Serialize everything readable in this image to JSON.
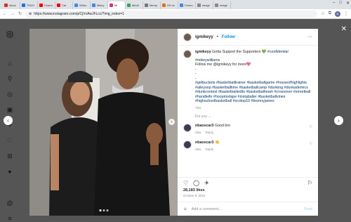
{
  "browser": {
    "tabs": [
      {
        "label": "Inbox",
        "color": "#d93025"
      },
      {
        "label": "TKWY",
        "color": "#1a73e8"
      },
      {
        "label": "Chann",
        "color": "#ff0000"
      },
      {
        "label": "Cal",
        "color": "#ff0000"
      },
      {
        "label": "When",
        "color": "#4285f4"
      },
      {
        "label": "Mikey",
        "color": "#4285f4"
      },
      {
        "label": "Mi",
        "color": "#e1306c"
      },
      {
        "label": "dfkdd",
        "color": "#34a853"
      },
      {
        "label": "Memp",
        "color": "#777"
      },
      {
        "label": "HS hc",
        "color": "#e8710a"
      },
      {
        "label": "Freem",
        "color": "#4285f4"
      },
      {
        "label": "image",
        "color": "#888"
      },
      {
        "label": "image",
        "color": "#888"
      }
    ],
    "url": "https://www.instagram.com/p/CjVvAwJFLcc/?img_index=1",
    "profile_initial": "N"
  },
  "post": {
    "username": "igmikeyy",
    "follow_label": "Follow",
    "more_label": "···",
    "caption_user": "igmikeyy",
    "caption_line1": "Gotta Support the Supporters 💚",
    "caption_tag1": "#confidential",
    "caption_tag2": "#mikeywilliams",
    "caption_follow": "Follow me @igmikeyy for more💖",
    "caption_dashes": "-\n-\n-",
    "hashtags": "#getbuckets #basketballtrainer #basketballgame #houseofhighlights #alleyoop #basketballtime #basketballcamp #dunking #dunkademics #dunkcontest #basketballedits #basketballteam #crossover #streetball #handleife #hoopmixtape #instaballer #basketballvines #highschoolbasketball #scotop10 #bronnyjames",
    "caption_time": "70w",
    "for_you_label": "For you ⌄",
    "comments": [
      {
        "user": "nbaoscar3",
        "text": "Good bro",
        "time": "28w",
        "reply": "Reply"
      },
      {
        "user": "nbaoscar3",
        "text": "👏",
        "time": "28w",
        "reply": "Reply"
      }
    ],
    "likes": "28,183 likes",
    "date": "October 5, 2022",
    "add_comment_placeholder": "Add a comment...",
    "post_label": "Post"
  },
  "sidebar_icons": [
    "instagram-icon",
    "home-icon",
    "search-icon",
    "explore-icon",
    "reels-icon",
    "messages-icon",
    "notifications-icon",
    "create-icon",
    "profile-icon"
  ]
}
